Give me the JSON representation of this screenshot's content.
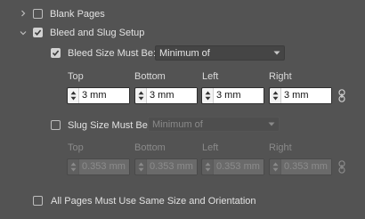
{
  "sections": {
    "blank_pages": {
      "label": "Blank Pages",
      "checked": false,
      "expanded": false
    },
    "bleed_slug": {
      "label": "Bleed and Slug Setup",
      "checked": true,
      "expanded": true
    }
  },
  "bleed": {
    "checkbox_label": "Bleed Size Must Be:",
    "checked": true,
    "dropdown_value": "Minimum of",
    "columns": [
      "Top",
      "Bottom",
      "Left",
      "Right"
    ],
    "values": [
      "3 mm",
      "3 mm",
      "3 mm",
      "3 mm"
    ]
  },
  "slug": {
    "checkbox_label": "Slug Size Must Be:",
    "checked": false,
    "dropdown_value": "Minimum of",
    "columns": [
      "Top",
      "Bottom",
      "Left",
      "Right"
    ],
    "values": [
      "0.353 mm",
      "0.353 mm",
      "0.353 mm",
      "0.353 mm"
    ]
  },
  "all_pages": {
    "label": "All Pages Must Use Same Size and Orientation",
    "checked": false
  },
  "colors": {
    "background": "#535353",
    "text": "#e2e2e2",
    "disabled_text": "#8d8d8d"
  }
}
